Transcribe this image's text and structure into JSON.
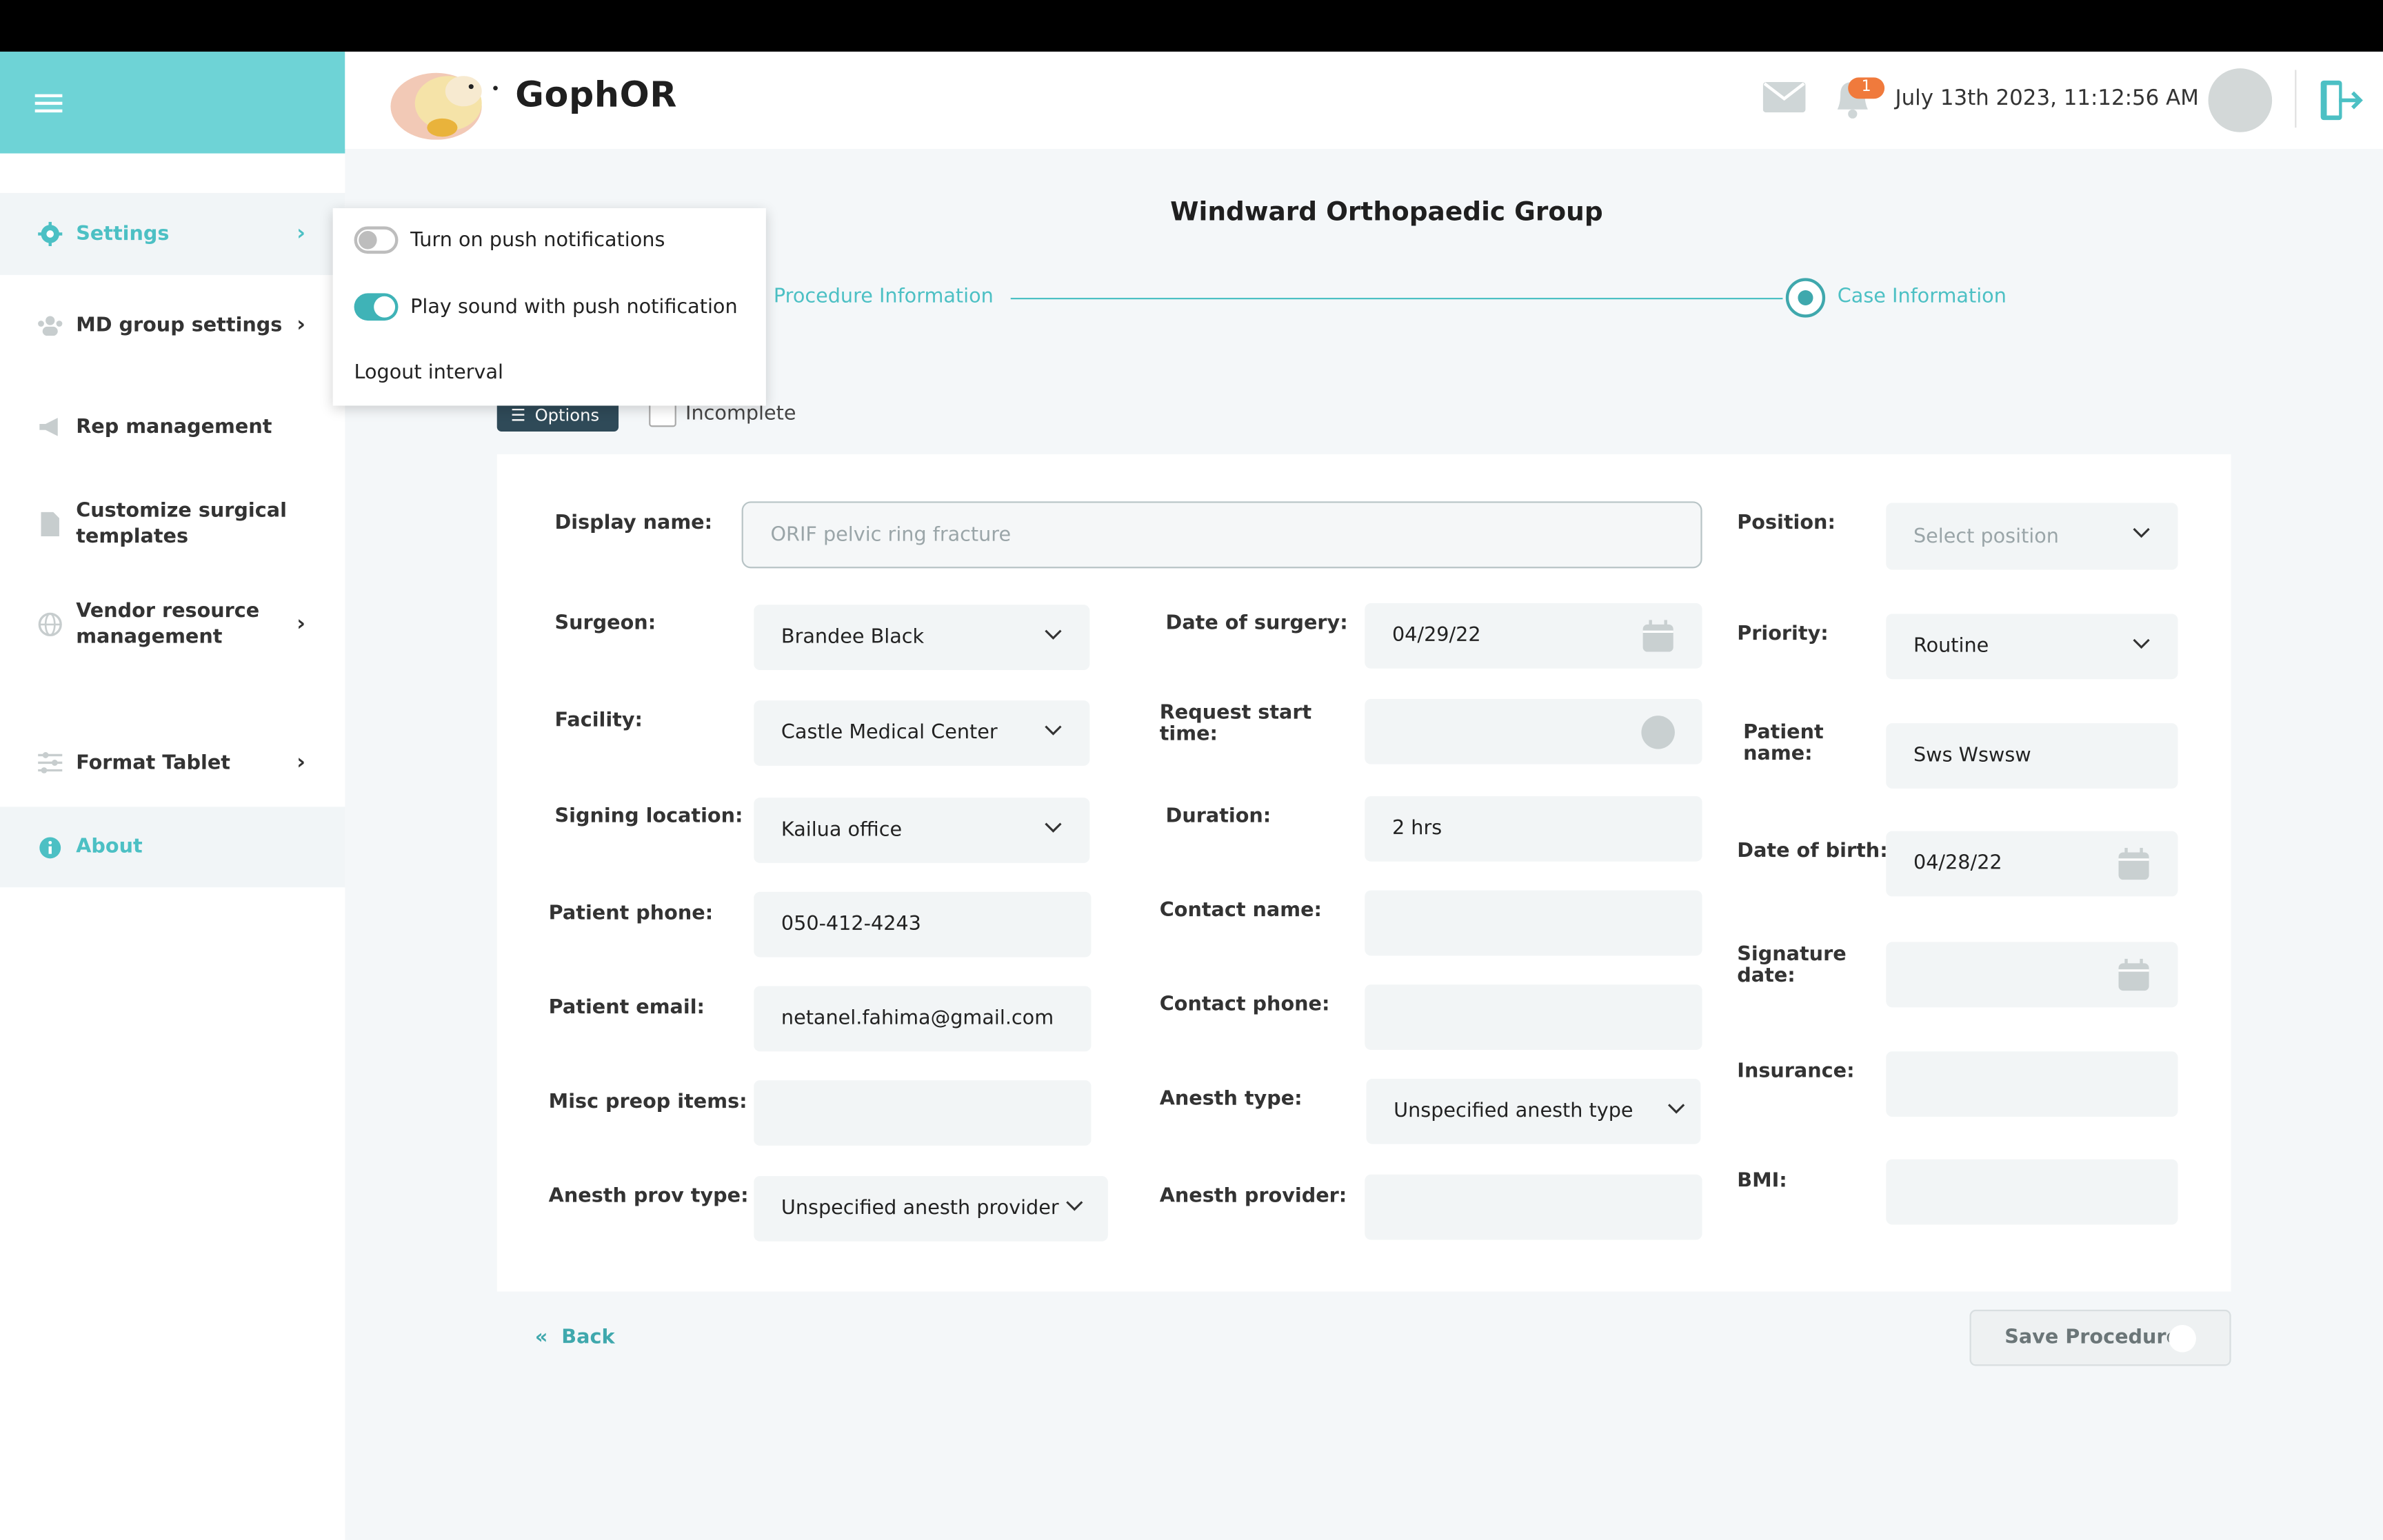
{
  "header": {
    "brand": "GophOR",
    "notification_count": "1",
    "datetime": "July 13th 2023, 11:12:56 AM"
  },
  "sidebar": {
    "items": [
      {
        "label": "Settings",
        "icon": "gear-icon",
        "active": true,
        "chevron": true
      },
      {
        "label": "MD group settings",
        "icon": "users-icon",
        "chevron": true
      },
      {
        "label": "Rep management",
        "icon": "megaphone-icon",
        "chevron": false
      },
      {
        "label": "Customize surgical templates",
        "icon": "document-icon",
        "chevron": false
      },
      {
        "label": "Vendor resource management",
        "icon": "globe-icon",
        "chevron": true
      },
      {
        "label": "Format Tablet",
        "icon": "sliders-icon",
        "chevron": true
      },
      {
        "label": "About",
        "icon": "info-icon",
        "active": true,
        "chevron": false
      }
    ]
  },
  "settings_dropdown": {
    "push_notifications": {
      "label": "Turn on push notifications",
      "on": false
    },
    "play_sound": {
      "label": "Play sound with push notification",
      "on": true
    },
    "logout_interval": "Logout interval"
  },
  "page": {
    "org_title": "Windward Orthopaedic Group",
    "steps": [
      "Procedure Information",
      "Case Information"
    ],
    "options_label": "Options",
    "incomplete_label": "Incomplete",
    "back_label": "Back",
    "save_label": "Save Procedure"
  },
  "form": {
    "display_name": {
      "label": "Display name:",
      "placeholder": "ORIF pelvic ring fracture"
    },
    "position": {
      "label": "Position:",
      "placeholder": "Select position"
    },
    "surgeon": {
      "label": "Surgeon:",
      "value": "Brandee Black"
    },
    "date_of_surgery": {
      "label": "Date of surgery:",
      "value": "04/29/22"
    },
    "priority": {
      "label": "Priority:",
      "value": "Routine"
    },
    "facility": {
      "label": "Facility:",
      "value": "Castle Medical Center"
    },
    "request_start_time": {
      "label": "Request start time:",
      "value": ""
    },
    "patient_name": {
      "label": "Patient name:",
      "value": "Sws Wswsw"
    },
    "signing_location": {
      "label": "Signing location:",
      "value": "Kailua office"
    },
    "duration": {
      "label": "Duration:",
      "value": "2 hrs"
    },
    "date_of_birth": {
      "label": "Date of birth:",
      "value": "04/28/22"
    },
    "patient_phone": {
      "label": "Patient phone:",
      "value": "050-412-4243"
    },
    "contact_name": {
      "label": "Contact name:",
      "value": ""
    },
    "signature_date": {
      "label": "Signature date:",
      "value": ""
    },
    "patient_email": {
      "label": "Patient email:",
      "value": "netanel.fahima@gmail.com"
    },
    "contact_phone": {
      "label": "Contact phone:",
      "value": ""
    },
    "insurance": {
      "label": "Insurance:",
      "value": ""
    },
    "misc_preop": {
      "label": "Misc preop items:",
      "value": ""
    },
    "anesth_type": {
      "label": "Anesth type:",
      "value": "Unspecified anesth type"
    },
    "bmi": {
      "label": "BMI:",
      "value": ""
    },
    "anesth_prov_type": {
      "label": "Anesth prov type:",
      "value": "Unspecified anesth provider"
    },
    "anesth_provider": {
      "label": "Anesth provider:",
      "value": ""
    }
  },
  "colors": {
    "accent": "#4cc0c4",
    "hamburger_bg": "#6ed3d6",
    "options_btn": "#2f4a58",
    "badge": "#f07a3c"
  }
}
